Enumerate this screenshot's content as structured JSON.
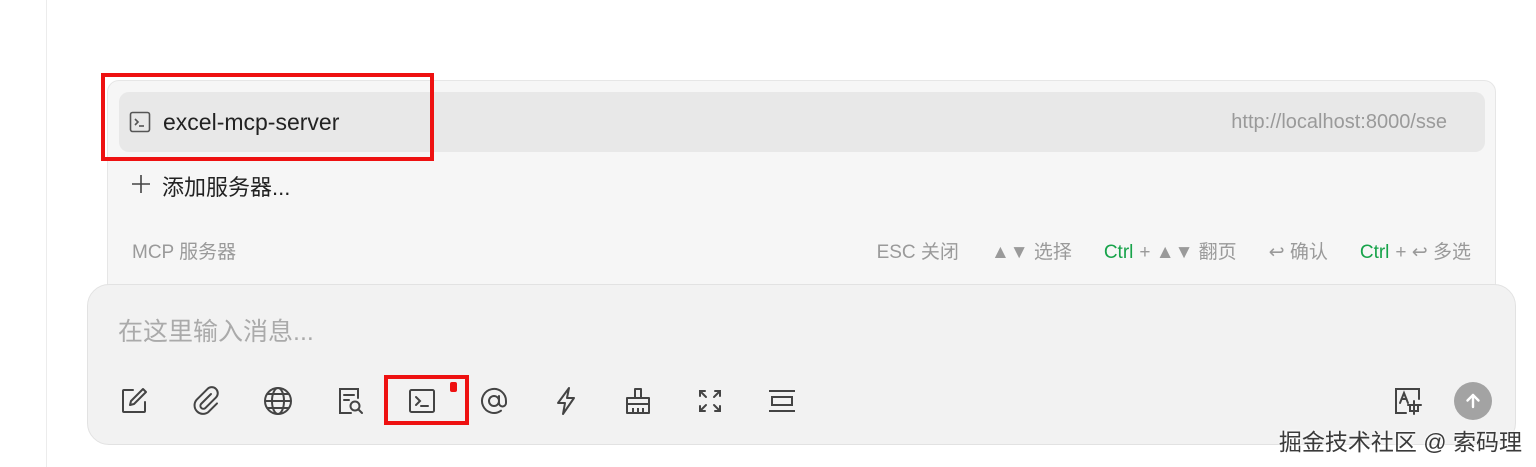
{
  "mcp_popup": {
    "server": {
      "name": "excel-mcp-server",
      "url": "http://localhost:8000/sse",
      "icon": "terminal-icon"
    },
    "add_server_label": "添加服务器...",
    "footer_title": "MCP 服务器",
    "hints": {
      "esc": "ESC 关闭",
      "select": "▲▼ 选择",
      "ctrl1": "Ctrl",
      "page": "+ ▲▼ 翻页",
      "confirm": "↩ 确认",
      "ctrl2": "Ctrl",
      "multi": "+ ↩ 多选"
    }
  },
  "chat_input": {
    "placeholder": "在这里输入消息...",
    "tools": [
      "edit-icon",
      "paperclip-icon",
      "globe-icon",
      "document-search-icon",
      "terminal-icon",
      "at-icon",
      "lightning-icon",
      "broom-icon",
      "expand-icon",
      "wrap-icon"
    ],
    "right_tools": [
      "image-translate-icon",
      "send-arrow-icon"
    ]
  },
  "watermark": "掘金技术社区 @ 索码理",
  "colors": {
    "accent_green": "#17a34a",
    "annotation_red": "#ee1111",
    "panel_bg": "#f6f6f6",
    "input_bg": "#f2f2f2"
  }
}
